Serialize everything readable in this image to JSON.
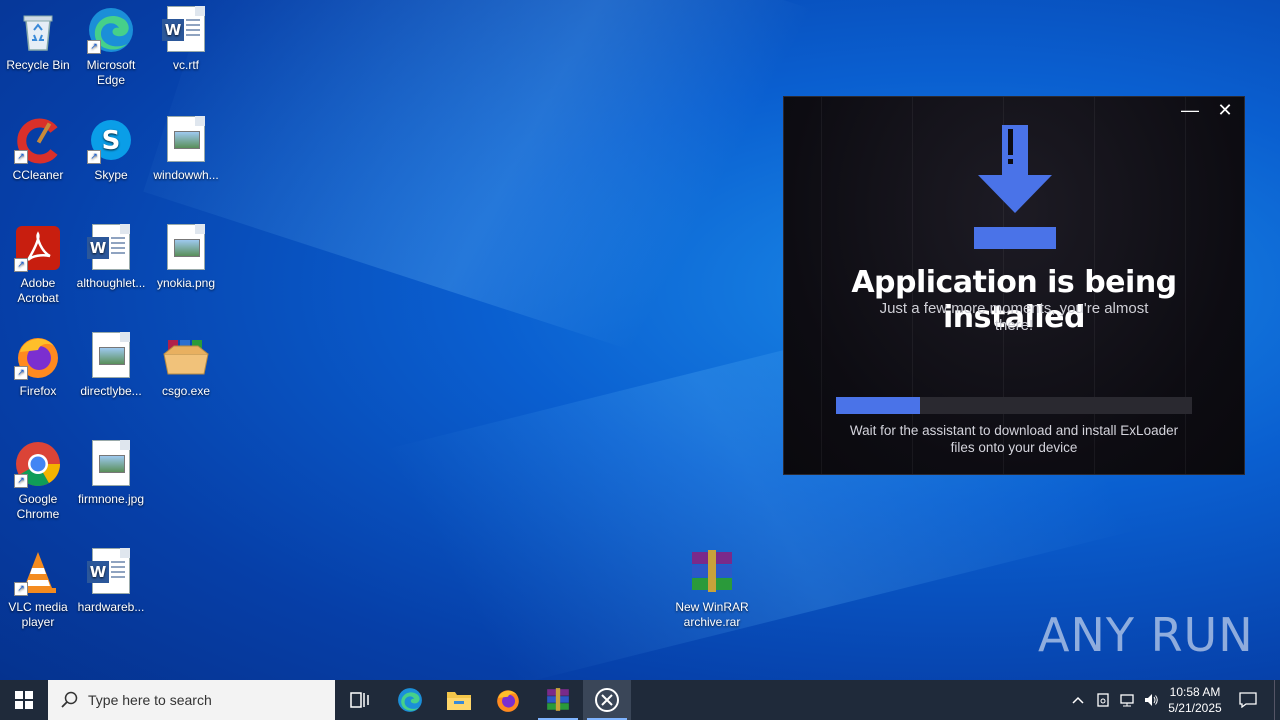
{
  "desktop_icons": {
    "recycle_bin": "Recycle Bin",
    "edge": "Microsoft Edge",
    "vc_rtf": "vc.rtf",
    "ccleaner": "CCleaner",
    "skype": "Skype",
    "windowwh": "windowwh...",
    "acrobat": "Adobe Acrobat",
    "althoughlet": "althoughlet...",
    "ynokia": "ynokia.png",
    "firefox": "Firefox",
    "directlybe": "directlybe...",
    "csgo": "csgo.exe",
    "chrome": "Google Chrome",
    "firmnone": "firmnone.jpg",
    "vlc": "VLC media player",
    "hardwareb": "hardwareb...",
    "winrar_archive": "New WinRAR archive.rar"
  },
  "installer": {
    "title": "Application is being installed",
    "subtitle": "Just a few more moments, you're almost there!",
    "footer": "Wait for the assistant to download and install ExLoader files onto your device",
    "progress_fraction": 0.235,
    "minimize_glyph": "—",
    "close_glyph": "✕"
  },
  "taskbar": {
    "search_placeholder": "Type here to search",
    "time": "10:58 AM",
    "date": "5/21/2025"
  },
  "watermark": "ANY RUN",
  "colors": {
    "accent": "#4a73e8",
    "taskbar": "#1f2a3a"
  }
}
